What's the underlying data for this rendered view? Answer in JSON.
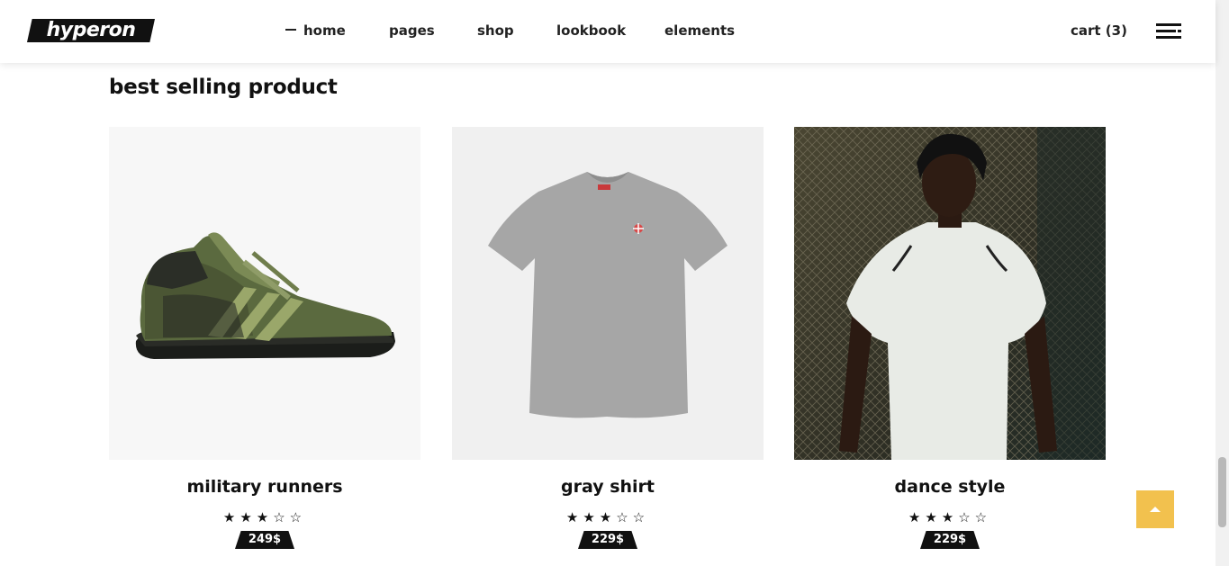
{
  "header": {
    "logo": "hyperon",
    "nav": [
      "home",
      "pages",
      "shop",
      "lookbook",
      "elements"
    ],
    "cart_label": "cart (3)"
  },
  "section": {
    "title": "best selling product"
  },
  "products": [
    {
      "name": "military runners",
      "rating": 3,
      "stars": "★★★☆☆",
      "price": "249$"
    },
    {
      "name": "gray shirt",
      "rating": 3,
      "stars": "★★★☆☆",
      "price": "229$"
    },
    {
      "name": "dance style",
      "rating": 3,
      "stars": "★★★☆☆",
      "price": "229$"
    }
  ],
  "colors": {
    "accent": "#f2c14e",
    "text": "#111111",
    "card_bg": "#f6f6f6"
  },
  "icons": [
    "menu-icon",
    "arrow-up-icon",
    "star-icon"
  ]
}
